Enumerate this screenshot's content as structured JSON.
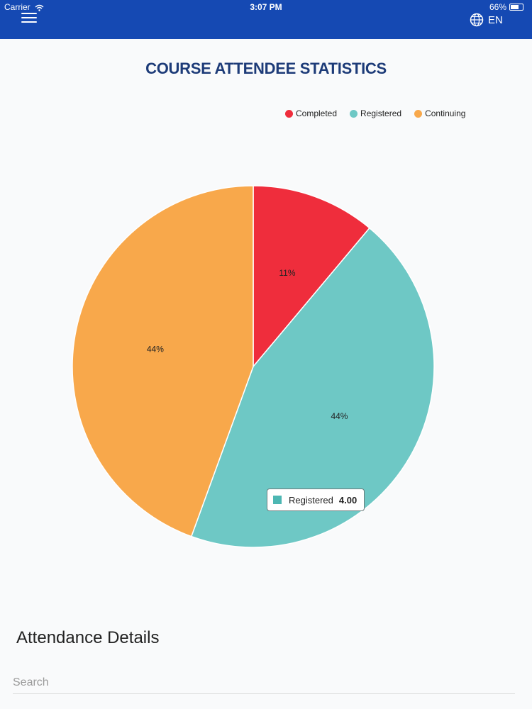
{
  "status_bar": {
    "carrier": "Carrier",
    "time": "3:07 PM",
    "battery": "66%"
  },
  "header": {
    "language": "EN"
  },
  "page": {
    "title": "COURSE ATTENDEE STATISTICS"
  },
  "chart_data": {
    "type": "pie",
    "title": "COURSE ATTENDEE STATISTICS",
    "legend_position": "top-right",
    "series": [
      {
        "name": "Completed",
        "value": 1,
        "label": "11%",
        "color": "#ef2d3c"
      },
      {
        "name": "Registered",
        "value": 4,
        "label": "44%",
        "color": "#6ec8c5"
      },
      {
        "name": "Continuing",
        "value": 4,
        "label": "44%",
        "color": "#f8a84b"
      }
    ],
    "tooltip": {
      "series": "Registered",
      "value": "4.00",
      "color": "#4db7b3"
    }
  },
  "details": {
    "title": "Attendance Details",
    "search_placeholder": "Search"
  }
}
